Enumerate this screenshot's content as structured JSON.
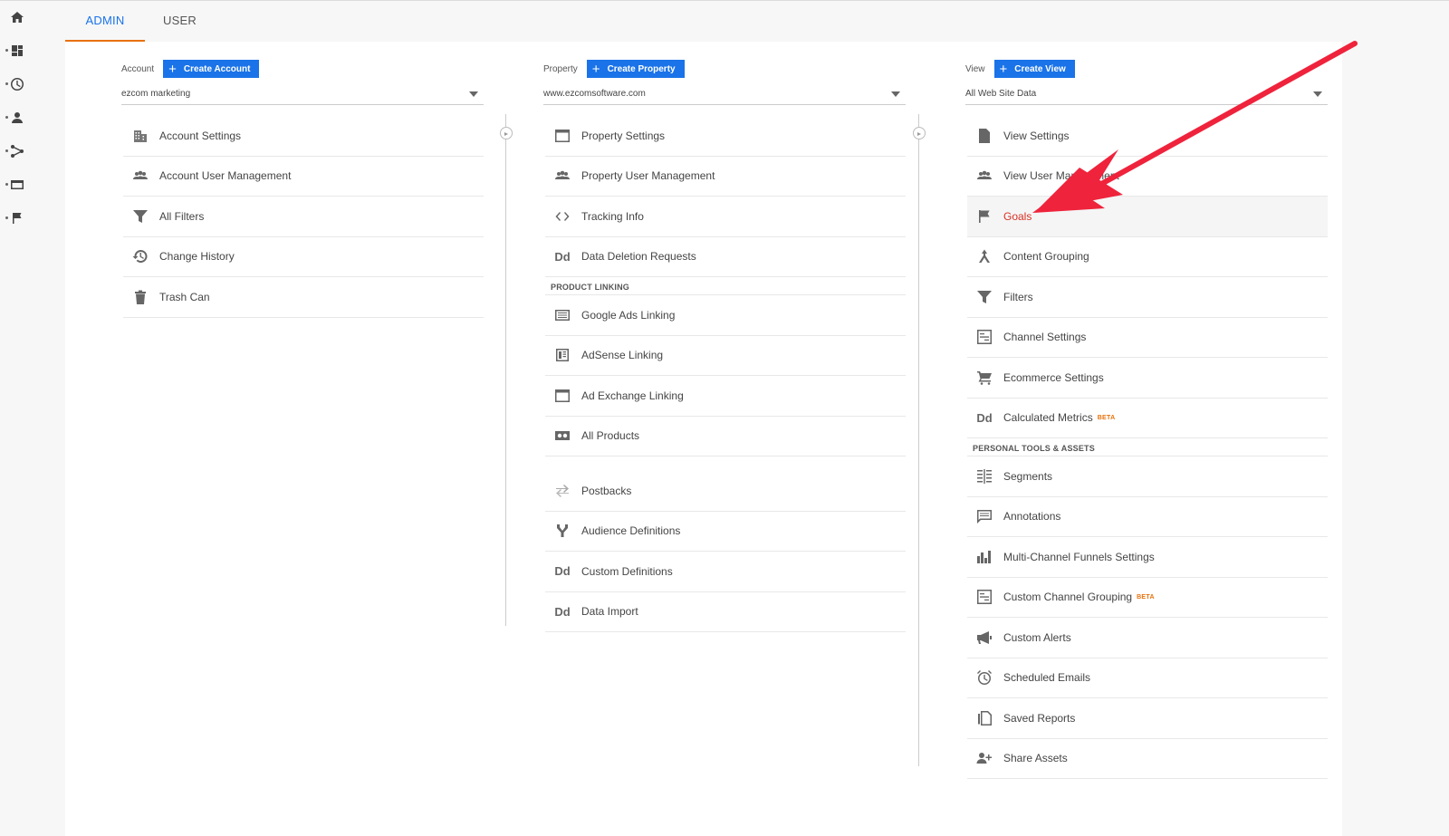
{
  "tabs": {
    "admin": "ADMIN",
    "user": "USER"
  },
  "account": {
    "label": "Account",
    "create_label": "Create Account",
    "selected": "ezcom marketing",
    "items": [
      {
        "label": "Account Settings",
        "icon": "building-icon"
      },
      {
        "label": "Account User Management",
        "icon": "people-icon"
      },
      {
        "label": "All Filters",
        "icon": "filter-icon"
      },
      {
        "label": "Change History",
        "icon": "history-icon"
      },
      {
        "label": "Trash Can",
        "icon": "trash-icon"
      }
    ]
  },
  "property": {
    "label": "Property",
    "create_label": "Create Property",
    "selected": "www.ezcomsoftware.com",
    "items": [
      {
        "label": "Property Settings",
        "icon": "window-icon"
      },
      {
        "label": "Property User Management",
        "icon": "people-icon"
      },
      {
        "label": "Tracking Info",
        "icon": "code-icon"
      },
      {
        "label": "Data Deletion Requests",
        "icon": "dd-icon"
      }
    ],
    "section_product_linking": "PRODUCT LINKING",
    "linking_items": [
      {
        "label": "Google Ads Linking",
        "icon": "ads-icon"
      },
      {
        "label": "AdSense Linking",
        "icon": "adsense-icon"
      },
      {
        "label": "Ad Exchange Linking",
        "icon": "window-icon"
      },
      {
        "label": "All Products",
        "icon": "products-icon"
      }
    ],
    "other_items": [
      {
        "label": "Postbacks",
        "icon": "postbacks-icon"
      },
      {
        "label": "Audience Definitions",
        "icon": "fork-icon"
      },
      {
        "label": "Custom Definitions",
        "icon": "dd-icon"
      },
      {
        "label": "Data Import",
        "icon": "dd-icon"
      }
    ]
  },
  "view": {
    "label": "View",
    "create_label": "Create View",
    "selected": "All Web Site Data",
    "items": [
      {
        "label": "View Settings",
        "icon": "document-icon"
      },
      {
        "label": "View User Management",
        "icon": "people-icon"
      },
      {
        "label": "Goals",
        "icon": "flag-icon"
      },
      {
        "label": "Content Grouping",
        "icon": "grouping-icon"
      },
      {
        "label": "Filters",
        "icon": "filter-icon"
      },
      {
        "label": "Channel Settings",
        "icon": "channel-icon"
      },
      {
        "label": "Ecommerce Settings",
        "icon": "cart-icon"
      },
      {
        "label": "Calculated Metrics",
        "icon": "dd-icon",
        "badge": "BETA"
      }
    ],
    "section_personal": "PERSONAL TOOLS & ASSETS",
    "personal_items": [
      {
        "label": "Segments",
        "icon": "segments-icon"
      },
      {
        "label": "Annotations",
        "icon": "comment-icon"
      },
      {
        "label": "Multi-Channel Funnels Settings",
        "icon": "bars-icon"
      },
      {
        "label": "Custom Channel Grouping",
        "icon": "channel-icon",
        "badge": "BETA"
      },
      {
        "label": "Custom Alerts",
        "icon": "megaphone-icon"
      },
      {
        "label": "Scheduled Emails",
        "icon": "alarm-icon"
      },
      {
        "label": "Saved Reports",
        "icon": "copy-icon"
      },
      {
        "label": "Share Assets",
        "icon": "person-add-icon"
      }
    ]
  },
  "colors": {
    "accent": "#1a73e8",
    "tab_underline": "#e8710a",
    "highlight_text": "#d93025",
    "arrow": "#ef233c"
  }
}
